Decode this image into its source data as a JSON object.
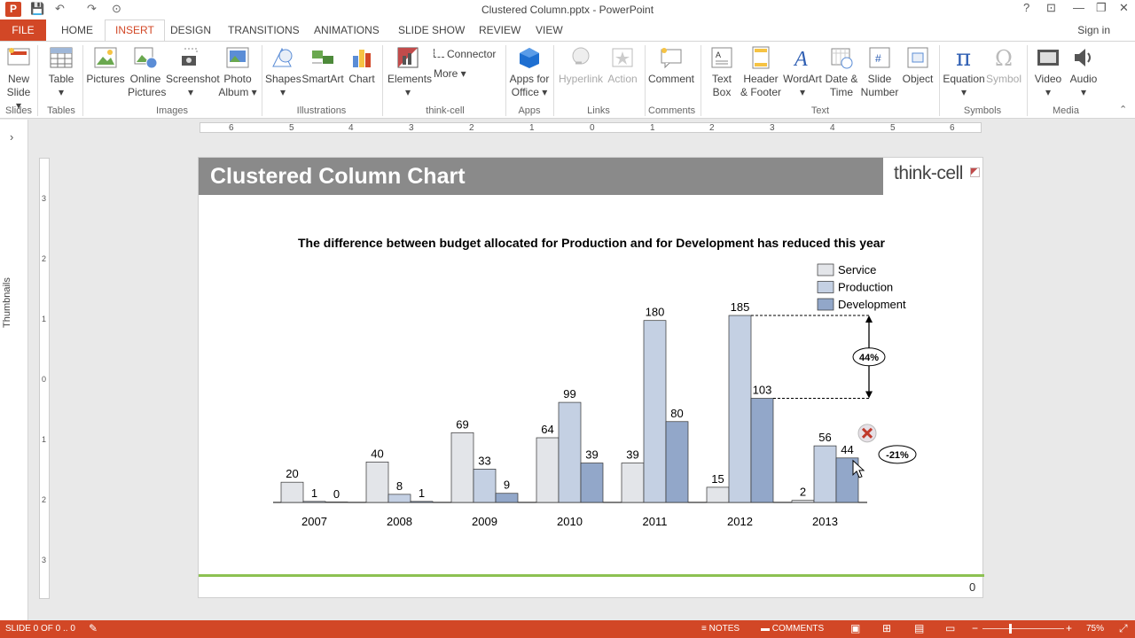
{
  "window": {
    "title": "Clustered Column.pptx - PowerPoint",
    "help": "?",
    "minimize": "—",
    "restore": "❐",
    "close": "✕",
    "ribbon_options": "⊡"
  },
  "quick_access": {
    "save": "💾",
    "undo": "↶",
    "redo": "↷",
    "customize": "⊙"
  },
  "tabs": [
    "FILE",
    "HOME",
    "INSERT",
    "DESIGN",
    "TRANSITIONS",
    "ANIMATIONS",
    "SLIDE SHOW",
    "REVIEW",
    "VIEW"
  ],
  "signin": "Sign in",
  "ribbon": {
    "groups": [
      "Slides",
      "Tables",
      "Images",
      "Illustrations",
      "think-cell",
      "Apps",
      "Links",
      "Comments",
      "Text",
      "Symbols",
      "Media"
    ],
    "buttons": {
      "new_slide": [
        "New",
        "Slide ▾"
      ],
      "table": [
        "Table",
        "▾"
      ],
      "pictures": [
        "Pictures"
      ],
      "online_pictures": [
        "Online",
        "Pictures"
      ],
      "screenshot": [
        "Screenshot",
        "▾"
      ],
      "photo_album": [
        "Photo",
        "Album ▾"
      ],
      "shapes": [
        "Shapes",
        "▾"
      ],
      "smartart": [
        "SmartArt"
      ],
      "chart": [
        "Chart"
      ],
      "elements": [
        "Elements",
        "▾"
      ],
      "connector": "Connector",
      "more": "More ▾",
      "apps_for_office": [
        "Apps for",
        "Office ▾"
      ],
      "hyperlink": [
        "Hyperlink"
      ],
      "action": [
        "Action"
      ],
      "comment": [
        "Comment"
      ],
      "text_box": [
        "Text",
        "Box"
      ],
      "header_footer": [
        "Header",
        "& Footer"
      ],
      "wordart": [
        "WordArt",
        "▾"
      ],
      "date_time": [
        "Date &",
        "Time"
      ],
      "slide_number": [
        "Slide",
        "Number"
      ],
      "object": [
        "Object"
      ],
      "equation": [
        "Equation",
        "▾"
      ],
      "symbol": [
        "Symbol"
      ],
      "video": [
        "Video",
        "▾"
      ],
      "audio": [
        "Audio",
        "▾"
      ]
    }
  },
  "left_panel": {
    "label": "Thumbnails",
    "expand": "›"
  },
  "ruler": {
    "h_ticks": [
      "6",
      "5",
      "4",
      "3",
      "2",
      "1",
      "0",
      "1",
      "2",
      "3",
      "4",
      "5",
      "6"
    ],
    "v_ticks": [
      "3",
      "2",
      "1",
      "0",
      "1",
      "2",
      "3"
    ]
  },
  "slide": {
    "title": "Clustered Column Chart",
    "logo": "think-cell",
    "subtitle": "The difference between budget allocated for Production and for Development has reduced this year",
    "page_number": "0",
    "difference_label": "44%",
    "overlay_label": "-21%"
  },
  "colors": {
    "service": "#e3e5e9",
    "production": "#c4d0e3",
    "development": "#92a7c9",
    "accent": "#d24726",
    "green_line": "#8cc152"
  },
  "chart_data": {
    "type": "bar",
    "categories": [
      "2007",
      "2008",
      "2009",
      "2010",
      "2011",
      "2012",
      "2013"
    ],
    "series": [
      {
        "name": "Service",
        "values": [
          20,
          40,
          69,
          64,
          39,
          15,
          2
        ]
      },
      {
        "name": "Production",
        "values": [
          1,
          8,
          33,
          99,
          180,
          185,
          56
        ]
      },
      {
        "name": "Development",
        "values": [
          0,
          1,
          9,
          39,
          80,
          103,
          44
        ]
      }
    ],
    "value_labels": [
      [
        "20",
        "40",
        "69",
        "64",
        "39",
        "15",
        "2"
      ],
      [
        "1",
        "8",
        "33",
        "99",
        "180",
        "185",
        "56"
      ],
      [
        "0",
        "1",
        "9",
        "39",
        "80",
        "103",
        "44"
      ]
    ],
    "legend_position": "top-right",
    "ylim": [
      0,
      185
    ],
    "grid": false,
    "title": "The difference between budget allocated for Production and for Development has reduced this year"
  },
  "statusbar": {
    "slide_info": "SLIDE 0 OF 0 .. 0",
    "notes": "NOTES",
    "comments": "COMMENTS",
    "zoom_minus": "−",
    "zoom_plus": "+",
    "zoom": "75%"
  }
}
